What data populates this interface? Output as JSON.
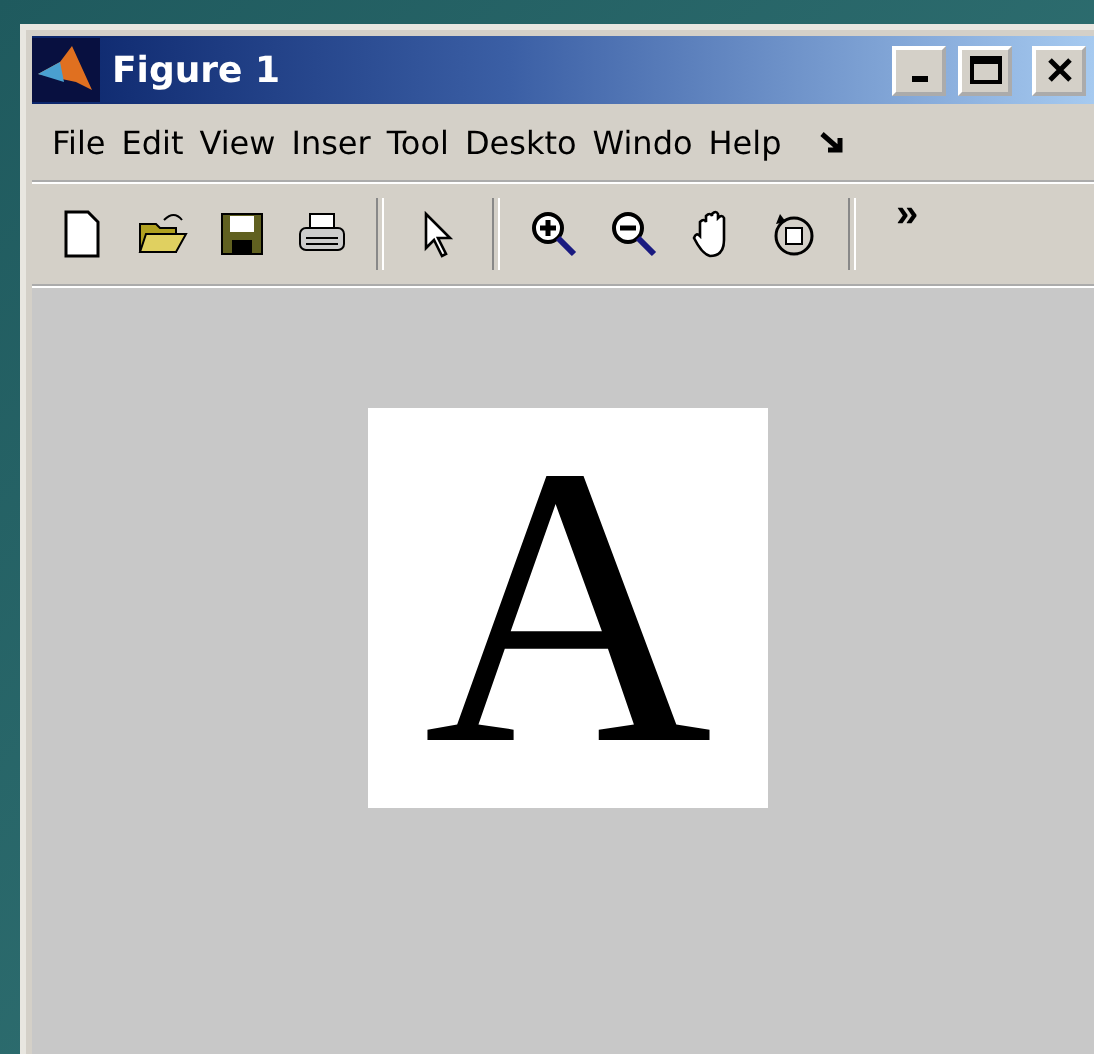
{
  "window": {
    "title": "Figure 1"
  },
  "menu": [
    "File",
    "Edit",
    "View",
    "Inser",
    "Tool",
    "Deskto",
    "Windo",
    "Help"
  ],
  "toolbar": {
    "overflow": "»"
  },
  "figure": {
    "text": "A"
  }
}
